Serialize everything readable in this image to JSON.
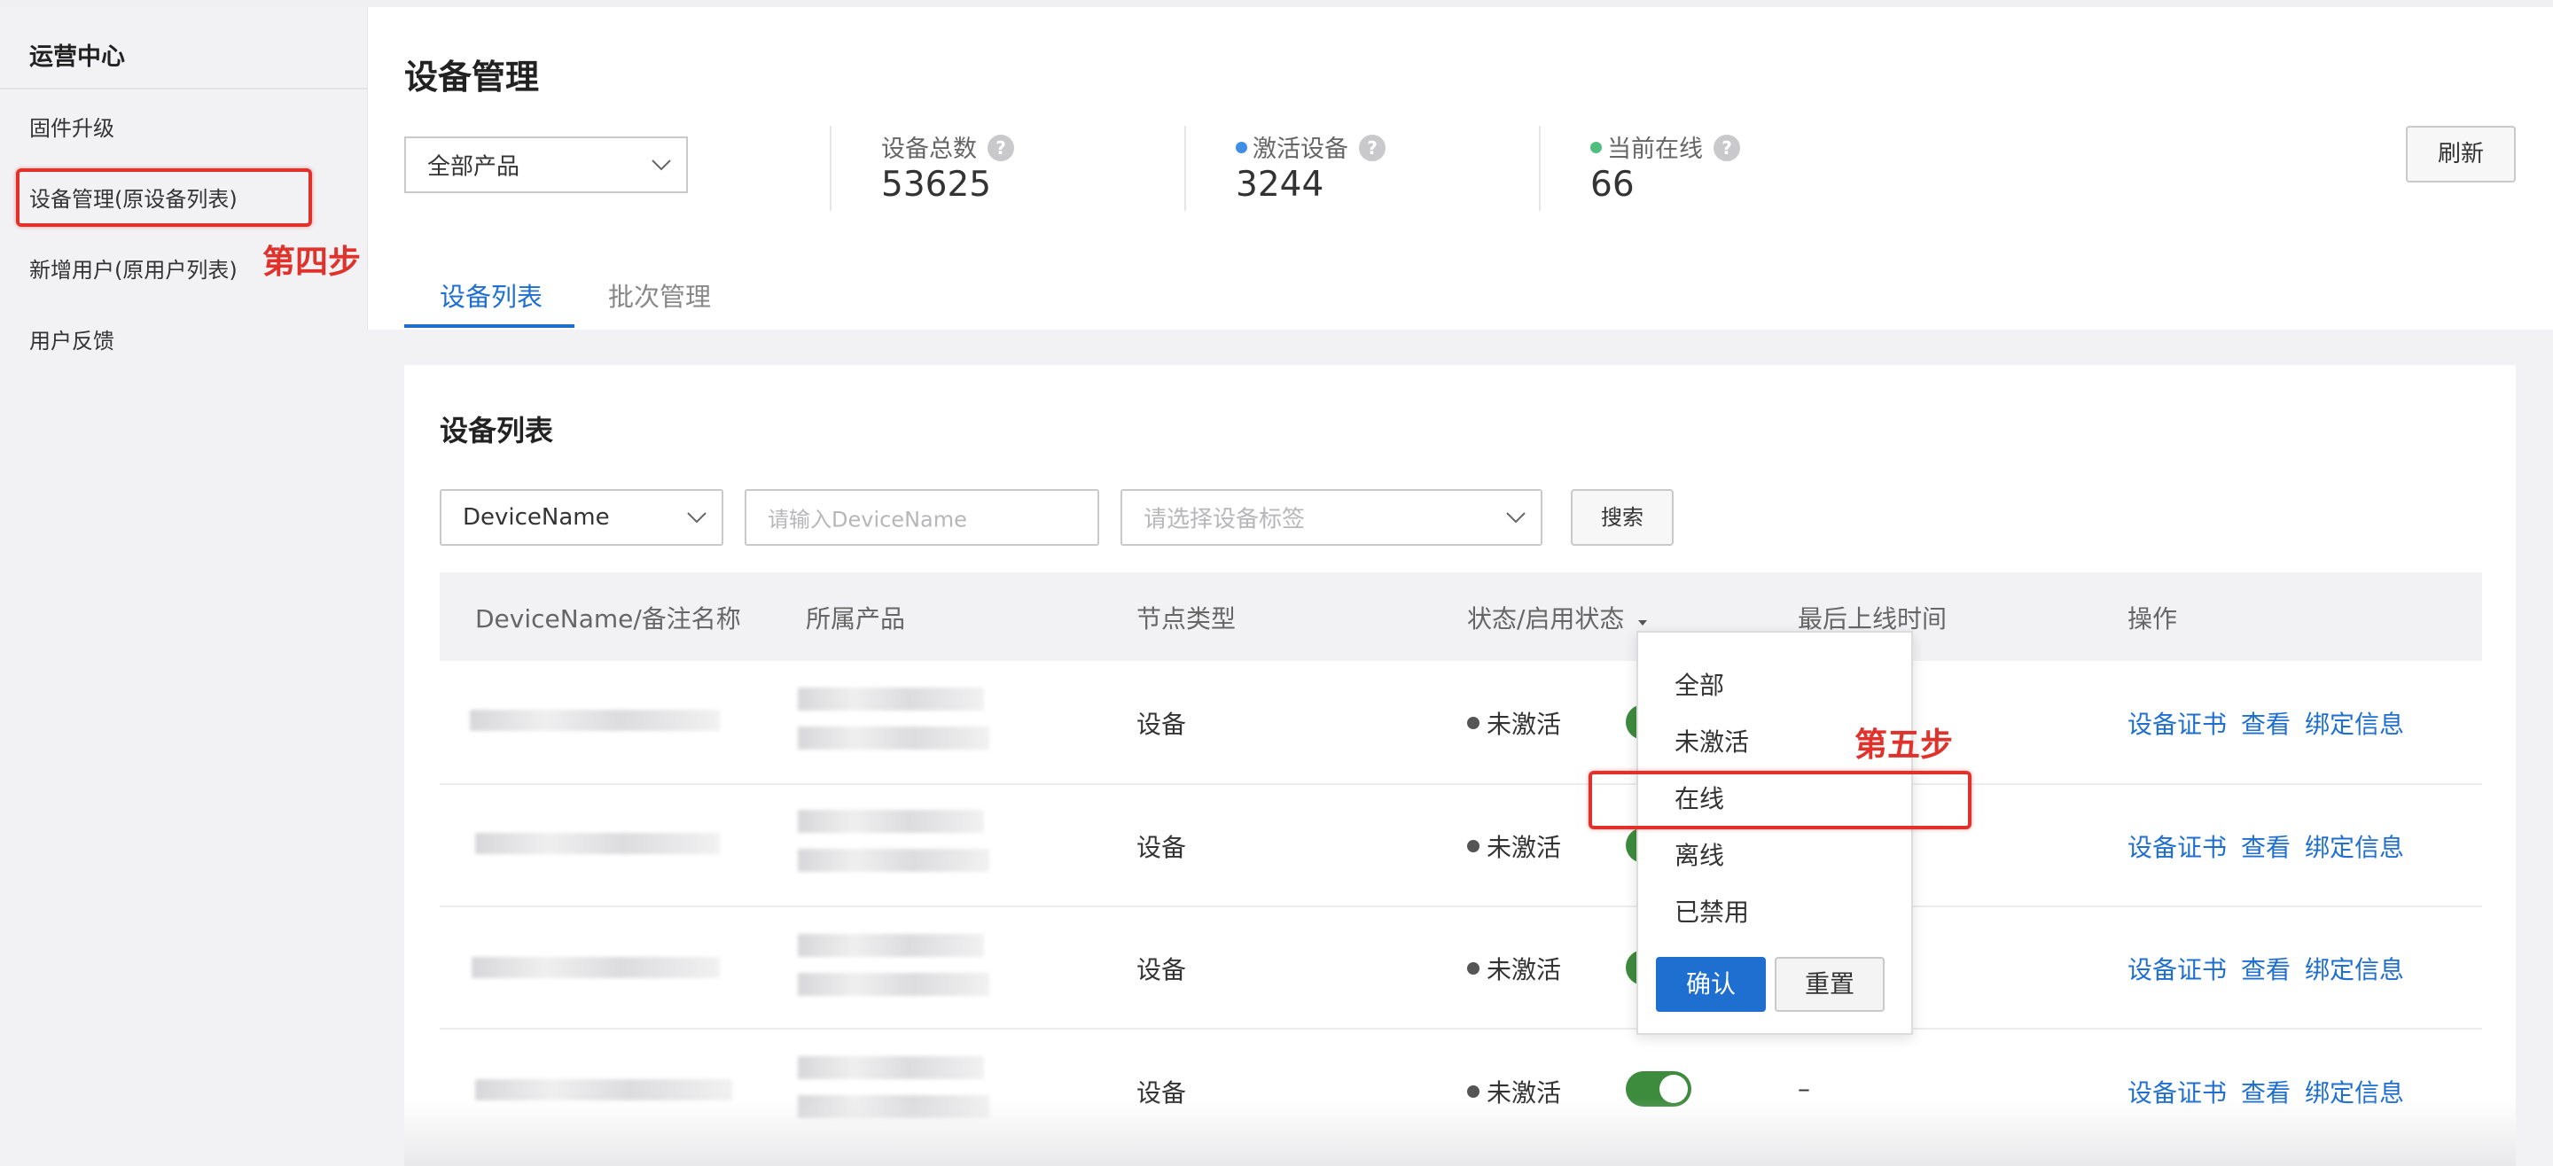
{
  "sidebar": {
    "title": "运营中心",
    "items": [
      {
        "label": "固件升级"
      },
      {
        "label": "设备管理(原设备列表)"
      },
      {
        "label": "新增用户(原用户列表)"
      },
      {
        "label": "用户反馈"
      }
    ]
  },
  "annotations": {
    "step4": "第四步",
    "step5": "第五步",
    "color": "#e0322b"
  },
  "header": {
    "title": "设备管理",
    "product_select": "全部产品",
    "refresh_label": "刷新"
  },
  "stats": [
    {
      "label": "设备总数",
      "value": "53625",
      "dot": ""
    },
    {
      "label": "激活设备",
      "value": "3244",
      "dot": "#3f8ee6"
    },
    {
      "label": "当前在线",
      "value": "66",
      "dot": "#4fbf7f"
    }
  ],
  "tabs": [
    {
      "label": "设备列表",
      "active": true
    },
    {
      "label": "批次管理",
      "active": false
    }
  ],
  "card": {
    "title": "设备列表",
    "filter_field": "DeviceName",
    "name_input_placeholder": "请输入DeviceName",
    "tag_select_placeholder": "请选择设备标签",
    "search_label": "搜索"
  },
  "table": {
    "columns": [
      "DeviceName/备注名称",
      "所属产品",
      "节点类型",
      "状态/启用状态",
      "最后上线时间",
      "操作"
    ],
    "rows": [
      {
        "node_type": "设备",
        "status": "未激活",
        "enabled": true,
        "last_online": ""
      },
      {
        "node_type": "设备",
        "status": "未激活",
        "enabled": true,
        "last_online": ""
      },
      {
        "node_type": "设备",
        "status": "未激活",
        "enabled": true,
        "last_online": ""
      },
      {
        "node_type": "设备",
        "status": "未激活",
        "enabled": true,
        "last_online": "–"
      }
    ],
    "actions": [
      "设备证书",
      "查看",
      "绑定信息"
    ]
  },
  "status_filter": {
    "options": [
      "全部",
      "未激活",
      "在线",
      "离线",
      "已禁用"
    ],
    "confirm_label": "确认",
    "reset_label": "重置"
  },
  "colors": {
    "accent": "#1f6fd1",
    "toggle_on": "#3d8b3d"
  }
}
